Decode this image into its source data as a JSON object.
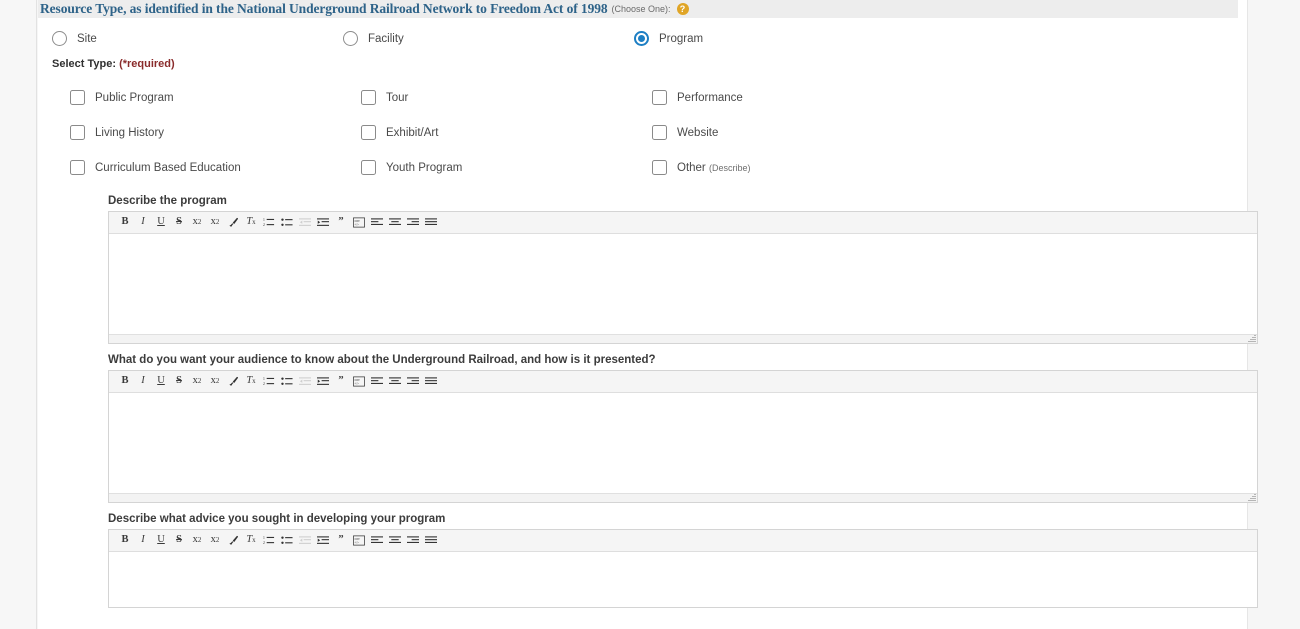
{
  "section": {
    "title": "Resource Type, as identified in the National Underground Railroad Network to Freedom Act of 1998",
    "note": "(Choose One):",
    "help_icon": "help-question-icon",
    "help_glyph": "?",
    "help_color": "#e0a526",
    "title_color": "#2e6389",
    "band_color": "#ededed"
  },
  "resource_type_radios": [
    {
      "label": "Site",
      "selected": false
    },
    {
      "label": "Facility",
      "selected": false
    },
    {
      "label": "Program",
      "selected": true
    }
  ],
  "select_type": {
    "label": "Select Type:",
    "required_note": "(*required)",
    "required_color": "#8a2b2b",
    "options": [
      {
        "label": "Public Program",
        "checked": false
      },
      {
        "label": "Tour",
        "checked": false
      },
      {
        "label": "Performance",
        "checked": false
      },
      {
        "label": "Living History",
        "checked": false
      },
      {
        "label": "Exhibit/Art",
        "checked": false
      },
      {
        "label": "Website",
        "checked": false
      },
      {
        "label": "Curriculum Based Education",
        "checked": false
      },
      {
        "label": "Youth Program",
        "checked": false
      },
      {
        "label": "Other",
        "sub": "(Describe)",
        "checked": false
      }
    ]
  },
  "editors": [
    {
      "label": "Describe the program",
      "value": ""
    },
    {
      "label": "What do you want your audience to know about the Underground Railroad, and how is it presented?",
      "value": ""
    },
    {
      "label": "Describe what advice you sought in developing your program",
      "value": ""
    }
  ],
  "toolbar": {
    "buttons": [
      {
        "name": "bold",
        "glyph": "B",
        "disabled": false
      },
      {
        "name": "italic",
        "glyph": "I",
        "disabled": false
      },
      {
        "name": "underline",
        "glyph": "U",
        "disabled": false
      },
      {
        "name": "strikethrough",
        "glyph": "S",
        "disabled": false
      },
      {
        "name": "subscript",
        "glyph": "x",
        "disabled": false
      },
      {
        "name": "superscript",
        "glyph": "x",
        "disabled": false
      },
      {
        "name": "remove-format-brush",
        "glyph": "",
        "disabled": false
      },
      {
        "name": "remove-formatting",
        "glyph": "T",
        "disabled": false
      },
      {
        "name": "numbered-list",
        "glyph": "",
        "disabled": false
      },
      {
        "name": "bulleted-list",
        "glyph": "",
        "disabled": false
      },
      {
        "name": "decrease-indent",
        "glyph": "",
        "disabled": true
      },
      {
        "name": "increase-indent",
        "glyph": "",
        "disabled": false
      },
      {
        "name": "blockquote",
        "glyph": "”",
        "disabled": false
      },
      {
        "name": "source-code",
        "glyph": "",
        "disabled": false
      },
      {
        "name": "align-left",
        "glyph": "",
        "disabled": false
      },
      {
        "name": "align-center",
        "glyph": "",
        "disabled": false
      },
      {
        "name": "align-right",
        "glyph": "",
        "disabled": false
      },
      {
        "name": "align-justify",
        "glyph": "",
        "disabled": false
      }
    ]
  }
}
